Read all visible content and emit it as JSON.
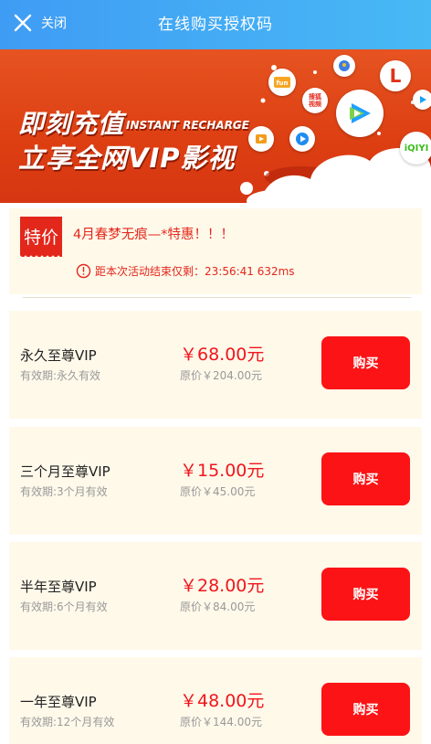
{
  "header": {
    "close_label": "关闭",
    "title": "在线购买授权码"
  },
  "banner": {
    "line1": "即刻充值",
    "line1_en": "INSTANT RECHARGE",
    "line2": "立享全网VIP影视",
    "app_icons": [
      "fun-icon",
      "letv-icon",
      "sohu-icon",
      "tencent-video-icon",
      "mgtv-icon",
      "youku-icon",
      "iqiyi-icon",
      "location-pin-icon"
    ],
    "sohu_text": "搜狐\n视频",
    "iqiyi_text": "iQIYI",
    "letv_text": "L"
  },
  "promo": {
    "tag": "特价",
    "text": "4月春梦无痕—*特惠！！！",
    "countdown": "距本次活动结束仅剩：23:56:41 632ms"
  },
  "plans": [
    {
      "name": "永久至尊VIP",
      "validity": "有效期:永久有效",
      "price": "￥68.00元",
      "original": "原价￥204.00元",
      "button": "购买"
    },
    {
      "name": "三个月至尊VIP",
      "validity": "有效期:3个月有效",
      "price": "￥15.00元",
      "original": "原价￥45.00元",
      "button": "购买"
    },
    {
      "name": "半年至尊VIP",
      "validity": "有效期:6个月有效",
      "price": "￥28.00元",
      "original": "原价￥84.00元",
      "button": "购买"
    },
    {
      "name": "一年至尊VIP",
      "validity": "有效期:12个月有效",
      "price": "￥48.00元",
      "original": "原价￥144.00元",
      "button": "购买"
    }
  ],
  "colors": {
    "header": "#43aaf5",
    "banner": "#e0461a",
    "accent_red": "#f0161d",
    "card_bg": "#fff9ea"
  }
}
